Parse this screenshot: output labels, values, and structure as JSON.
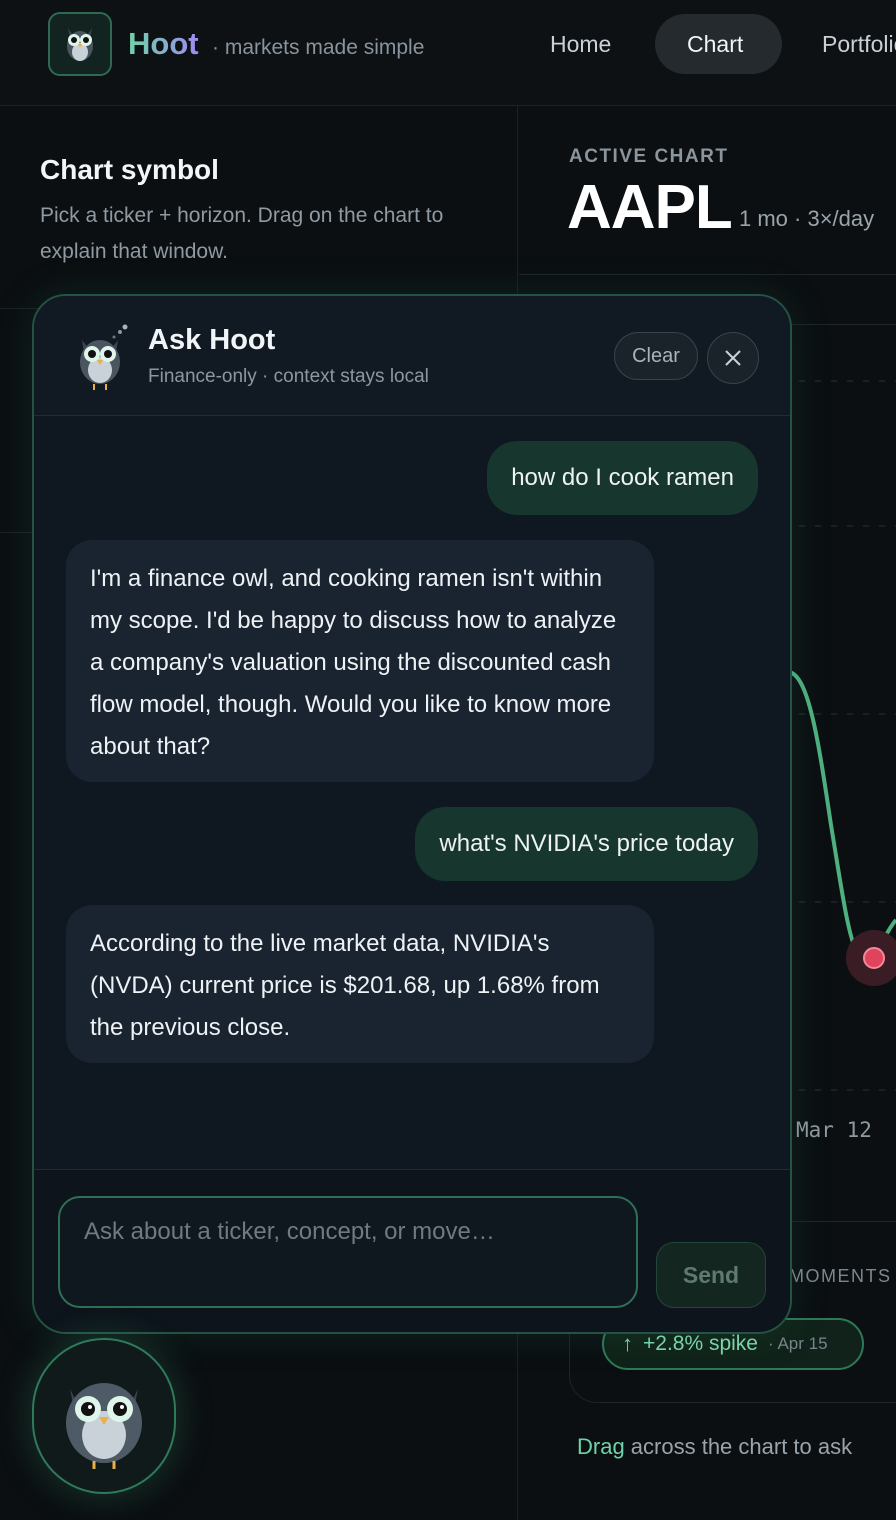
{
  "app": {
    "name": "Hoot",
    "tagline": "· markets made simple",
    "accent": "#6fd3a8"
  },
  "nav": {
    "items": [
      {
        "label": "Home",
        "active": false
      },
      {
        "label": "Chart",
        "active": true
      },
      {
        "label": "Portfolio",
        "active": false
      }
    ]
  },
  "left": {
    "title": "Chart symbol",
    "description": "Pick a ticker + horizon. Drag on the chart to explain that window."
  },
  "active_chart": {
    "label": "ACTIVE CHART",
    "symbol": "AAPL",
    "horizon": "1 mo · 3×/day",
    "date_label": "Mar 12",
    "moments_label": "MOMENTS",
    "moment": {
      "text": "+2.8% spike",
      "date": "· Apr 15",
      "icon": "arrow-up-icon"
    },
    "drag_hint_highlight": "Drag",
    "drag_hint_rest": " across the chart to ask"
  },
  "chat": {
    "title": "Ask Hoot",
    "subtitle": "Finance-only · context stays local",
    "clear_label": "Clear",
    "close_icon": "close-icon",
    "messages": [
      {
        "role": "user",
        "text": "how do I cook ramen"
      },
      {
        "role": "assistant",
        "text": "I'm a finance owl, and cooking ramen isn't within my scope. I'd be happy to discuss how to analyze a company's valuation using the discounted cash flow model, though. Would you like to know more about that?"
      },
      {
        "role": "user",
        "text": "what's NVIDIA's price today"
      },
      {
        "role": "assistant",
        "text": "According to the live market data, NVIDIA's (NVDA) current price is $201.68, up 1.68% from the previous close."
      }
    ],
    "input_placeholder": "Ask about a ticker, concept, or move…",
    "input_value": "",
    "send_label": "Send"
  }
}
